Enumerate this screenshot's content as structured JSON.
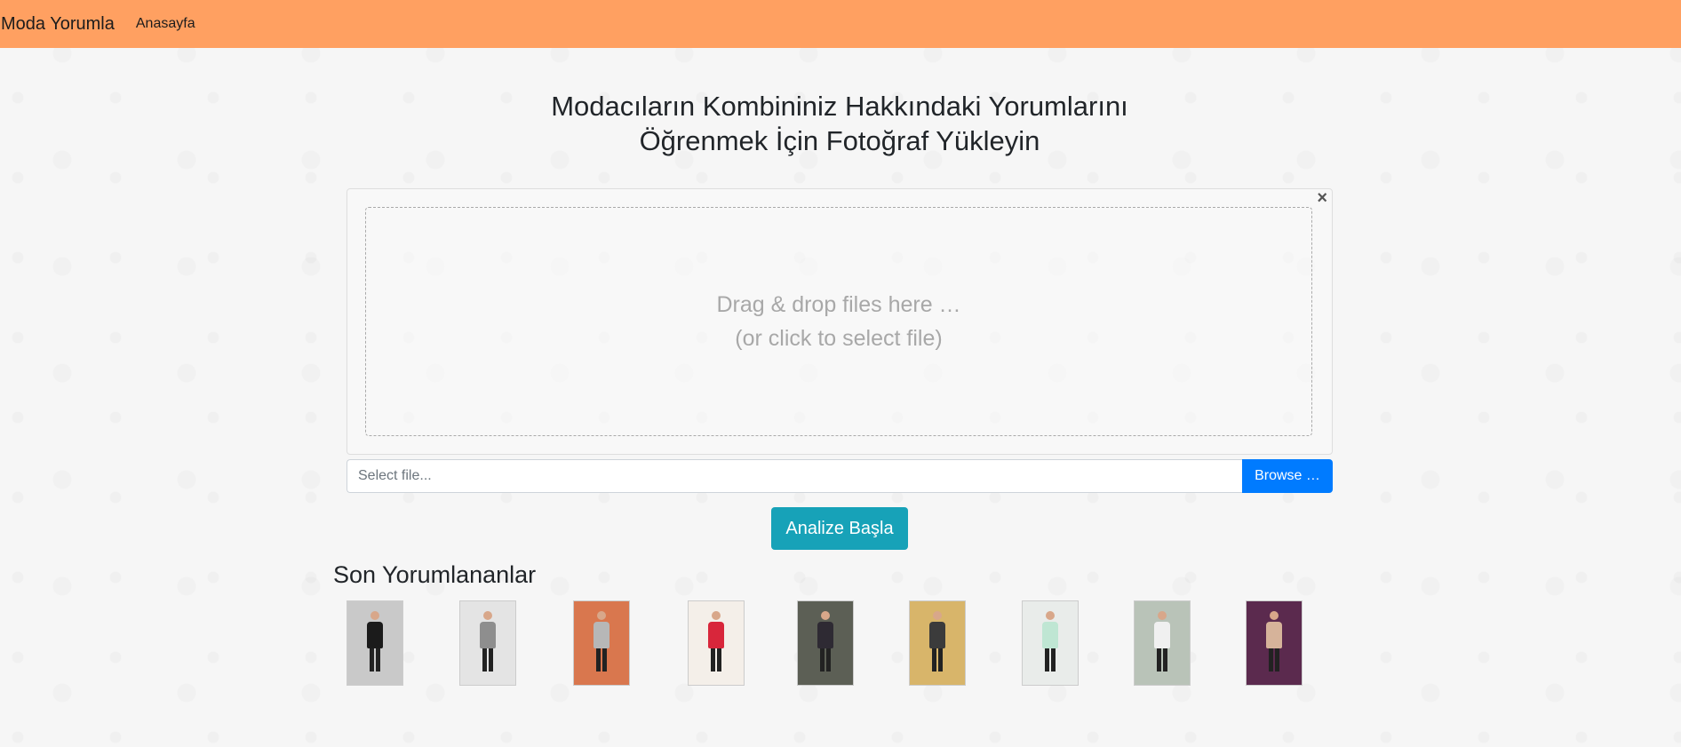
{
  "navbar": {
    "brand": "Moda Yorumla",
    "links": [
      "Anasayfa"
    ]
  },
  "main": {
    "title_line1": "Modacıların Kombininiz Hakkındaki Yorumlarını",
    "title_line2": "Öğrenmek İçin Fotoğraf Yükleyin"
  },
  "upload": {
    "drop_line1": "Drag & drop files here …",
    "drop_line2": "(or click to select file)",
    "close_symbol": "×",
    "file_placeholder": "Select file...",
    "browse_label": "Browse …",
    "analyze_label": "Analize Başla"
  },
  "recent": {
    "title": "Son Yorumlananlar",
    "thumbnails": [
      {
        "bg": "#c9c9c9",
        "outfit": "#1b1b1b"
      },
      {
        "bg": "#e4e4e4",
        "outfit": "#8e8e8e"
      },
      {
        "bg": "#d9774e",
        "outfit": "#b7b7b7"
      },
      {
        "bg": "#f4efe9",
        "outfit": "#d8263b"
      },
      {
        "bg": "#5c5f55",
        "outfit": "#2e2a33"
      },
      {
        "bg": "#d8b56a",
        "outfit": "#3b3b3b"
      },
      {
        "bg": "#e9ecea",
        "outfit": "#bfe6d3"
      },
      {
        "bg": "#b9c3b8",
        "outfit": "#f0f0f0"
      },
      {
        "bg": "#5b2a4e",
        "outfit": "#d6b39a"
      }
    ]
  },
  "colors": {
    "navbar": "#ffa061",
    "browse_button": "#007bff",
    "analyze_button": "#17a2b8"
  }
}
